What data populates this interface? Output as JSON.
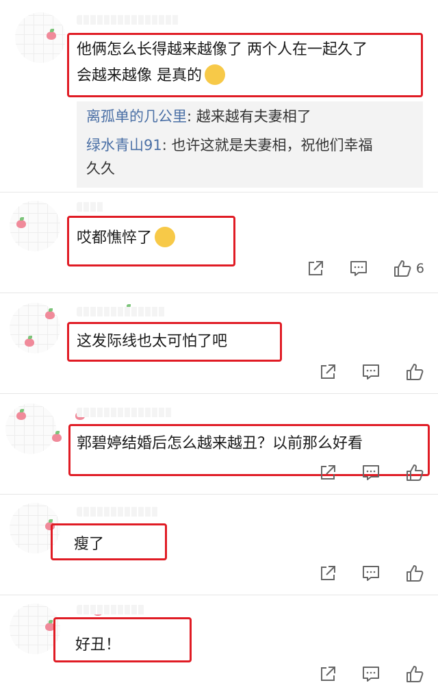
{
  "comments": [
    {
      "text_line1": "他俩怎么长得越来越像了 两个人在一起久了",
      "text_line2": "会越来越像 是真的",
      "emoji": "laughing-tears-emoji",
      "replies": [
        {
          "name": "离孤单的几公里",
          "sep": ": ",
          "text": "越来越有夫妻相了"
        },
        {
          "name": "绿水青山91",
          "sep": ": ",
          "text": "也许这就是夫妻相，祝他们幸福",
          "text2": "久久"
        }
      ]
    },
    {
      "text": "哎都憔悴了",
      "emoji": "crying-emoji",
      "likes": "6"
    },
    {
      "text": "这发际线也太可怕了吧"
    },
    {
      "text": "郭碧婷结婚后怎么越来越丑？以前那么好看"
    },
    {
      "text": "瘦了"
    },
    {
      "text": "好丑！"
    }
  ],
  "icons": {
    "share": "share-icon",
    "comment": "comment-icon",
    "like": "like-icon"
  },
  "colors": {
    "highlight": "#e01b24",
    "reply_name": "#4a6fa5",
    "reply_bg": "#f3f3f3"
  }
}
